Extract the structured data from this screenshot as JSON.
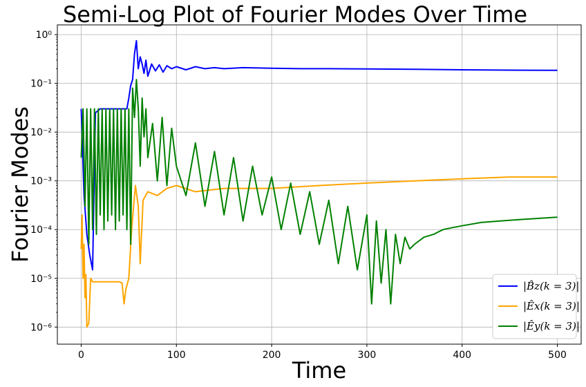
{
  "chart_data": {
    "type": "line",
    "title": "Semi-Log Plot of Fourier Modes Over Time",
    "xlabel": "Time",
    "ylabel": "Fourier Modes",
    "yscale": "log",
    "xlim": [
      -25,
      525
    ],
    "ylim_log10": [
      -6.35,
      0.2
    ],
    "x_ticks": [
      0,
      100,
      200,
      300,
      400,
      500
    ],
    "x_tick_labels": [
      "0",
      "100",
      "200",
      "300",
      "400",
      "500"
    ],
    "y_ticks_exp": [
      -6,
      -5,
      -4,
      -3,
      -2,
      -1,
      0
    ],
    "y_tick_labels": [
      "10⁻⁶",
      "10⁻⁵",
      "10⁻⁴",
      "10⁻³",
      "10⁻²",
      "10⁻¹",
      "10⁰"
    ],
    "grid": true,
    "legend_position": "lower-right",
    "series": [
      {
        "name": "|B̂z(k = 3)|",
        "color": "#0000ff",
        "x": [
          0,
          3,
          6,
          9,
          12,
          15,
          20,
          25,
          30,
          35,
          40,
          45,
          48,
          50,
          52,
          54,
          56,
          58,
          60,
          62,
          64,
          66,
          68,
          70,
          74,
          78,
          82,
          86,
          90,
          95,
          100,
          110,
          120,
          130,
          140,
          150,
          170,
          200,
          230,
          260,
          300,
          350,
          400,
          450,
          500
        ],
        "y": [
          0.03,
          0.0005,
          8e-05,
          3e-05,
          1.5e-05,
          0.025,
          0.03,
          0.03,
          0.03,
          0.03,
          0.03,
          0.03,
          0.03,
          0.05,
          0.09,
          0.12,
          0.4,
          0.75,
          0.2,
          0.35,
          0.25,
          0.16,
          0.3,
          0.14,
          0.25,
          0.18,
          0.24,
          0.17,
          0.23,
          0.2,
          0.22,
          0.19,
          0.22,
          0.2,
          0.21,
          0.2,
          0.21,
          0.205,
          0.2,
          0.2,
          0.198,
          0.195,
          0.19,
          0.187,
          0.185
        ]
      },
      {
        "name": "|Êx(k = 3)|",
        "color": "#ffa500",
        "x": [
          0,
          1,
          2,
          3,
          4,
          5,
          6,
          8,
          10,
          12,
          15,
          20,
          25,
          30,
          35,
          40,
          43,
          45,
          47,
          50,
          53,
          55,
          57,
          60,
          62,
          65,
          70,
          80,
          90,
          100,
          120,
          150,
          180,
          200,
          250,
          300,
          350,
          400,
          450,
          500
        ],
        "y": [
          4e-05,
          0.0002,
          1e-05,
          5e-05,
          4e-06,
          1.2e-05,
          1e-06,
          1.2e-06,
          1e-05,
          8.5e-06,
          8.5e-06,
          8.5e-06,
          8.5e-06,
          8.5e-06,
          8.5e-06,
          8.5e-06,
          8e-06,
          3e-06,
          6e-06,
          1e-05,
          0.0001,
          0.0003,
          0.0008,
          0.0003,
          2e-05,
          0.0004,
          0.0006,
          0.0005,
          0.0007,
          0.0008,
          0.0006,
          0.0007,
          0.0007,
          0.0007,
          0.0008,
          0.0009,
          0.001,
          0.0011,
          0.0012,
          0.0012
        ]
      },
      {
        "name": "|Êy(k = 3)|",
        "color": "#008000",
        "x": [
          0,
          2,
          4,
          6,
          8,
          10,
          12,
          14,
          16,
          18,
          20,
          22,
          24,
          26,
          28,
          30,
          32,
          34,
          36,
          38,
          40,
          42,
          44,
          46,
          48,
          50,
          52,
          54,
          56,
          58,
          60,
          62,
          64,
          66,
          68,
          70,
          75,
          80,
          85,
          90,
          95,
          100,
          110,
          120,
          130,
          140,
          150,
          160,
          170,
          180,
          190,
          200,
          210,
          220,
          230,
          240,
          250,
          260,
          270,
          280,
          290,
          300,
          305,
          310,
          315,
          320,
          325,
          330,
          335,
          340,
          345,
          350,
          360,
          370,
          380,
          390,
          400,
          420,
          440,
          460,
          480,
          500
        ],
        "y": [
          0.003,
          0.03,
          0.0003,
          0.03,
          5e-05,
          0.03,
          0.0001,
          0.03,
          8e-05,
          0.03,
          0.0002,
          0.03,
          0.0001,
          0.03,
          0.00015,
          0.03,
          0.0002,
          0.03,
          0.0001,
          0.03,
          0.00015,
          0.03,
          0.0002,
          0.03,
          0.0001,
          0.03,
          5e-05,
          0.08,
          0.02,
          0.12,
          0.03,
          0.002,
          0.05,
          0.008,
          0.03,
          0.003,
          0.015,
          0.001,
          0.02,
          0.0008,
          0.012,
          0.002,
          0.0005,
          0.006,
          0.0003,
          0.004,
          0.0002,
          0.003,
          0.00015,
          0.002,
          0.0002,
          0.0012,
          0.0001,
          0.0009,
          8e-05,
          0.0006,
          5e-05,
          0.0004,
          2e-05,
          0.0003,
          1.5e-05,
          0.0002,
          3e-06,
          0.00015,
          8e-06,
          0.0001,
          3e-06,
          8e-05,
          2e-05,
          7e-05,
          4e-05,
          5e-05,
          7e-05,
          8e-05,
          0.0001,
          0.00011,
          0.00012,
          0.00014,
          0.00015,
          0.00016,
          0.00017,
          0.00018
        ]
      }
    ]
  }
}
